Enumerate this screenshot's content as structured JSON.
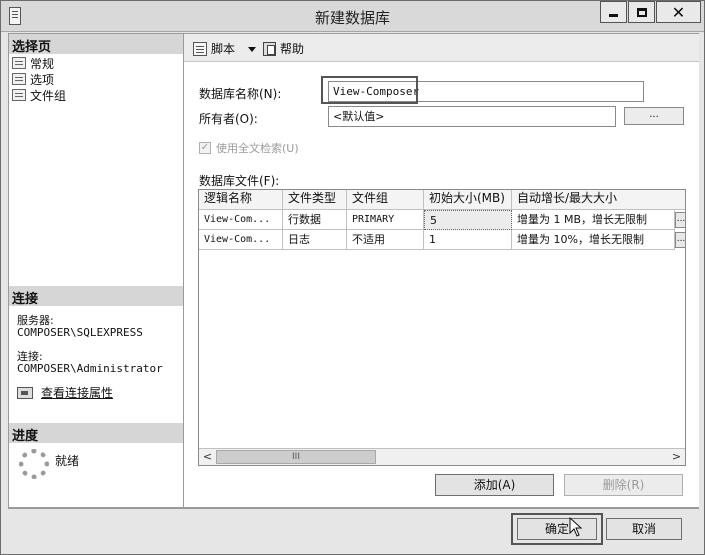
{
  "window": {
    "title": "新建数据库"
  },
  "left": {
    "select_page_header": "选择页",
    "pages": [
      "常规",
      "选项",
      "文件组"
    ],
    "connection_header": "连接",
    "server_label": "服务器:",
    "server_value": "COMPOSER\\SQLEXPRESS",
    "connection_label": "连接:",
    "connection_value": "COMPOSER\\Administrator",
    "view_connection_link": "查看连接属性",
    "progress_header": "进度",
    "status": "就绪"
  },
  "toolbar": {
    "script_label": "脚本",
    "help_label": "帮助"
  },
  "form": {
    "db_name_label": "数据库名称(N):",
    "db_name_value": "View-Composer",
    "owner_label": "所有者(O):",
    "owner_value": "<默认值>",
    "browse_button": "...",
    "fulltext_label": "使用全文检索(U)",
    "db_files_label": "数据库文件(F):"
  },
  "grid": {
    "columns": [
      "逻辑名称",
      "文件类型",
      "文件组",
      "初始大小(MB)",
      "自动增长/最大大小"
    ],
    "rows": [
      [
        "View-Com...",
        "行数据",
        "PRIMARY",
        "5",
        "增量为 1 MB，增长无限制"
      ],
      [
        "View-Com...",
        "日志",
        "不适用",
        "1",
        "增量为 10%，增长无限制"
      ]
    ],
    "row_button": "...",
    "scroll_thumb": "III"
  },
  "buttons": {
    "add": "添加(A)",
    "remove": "删除(R)",
    "ok": "确定",
    "cancel": "取消"
  }
}
